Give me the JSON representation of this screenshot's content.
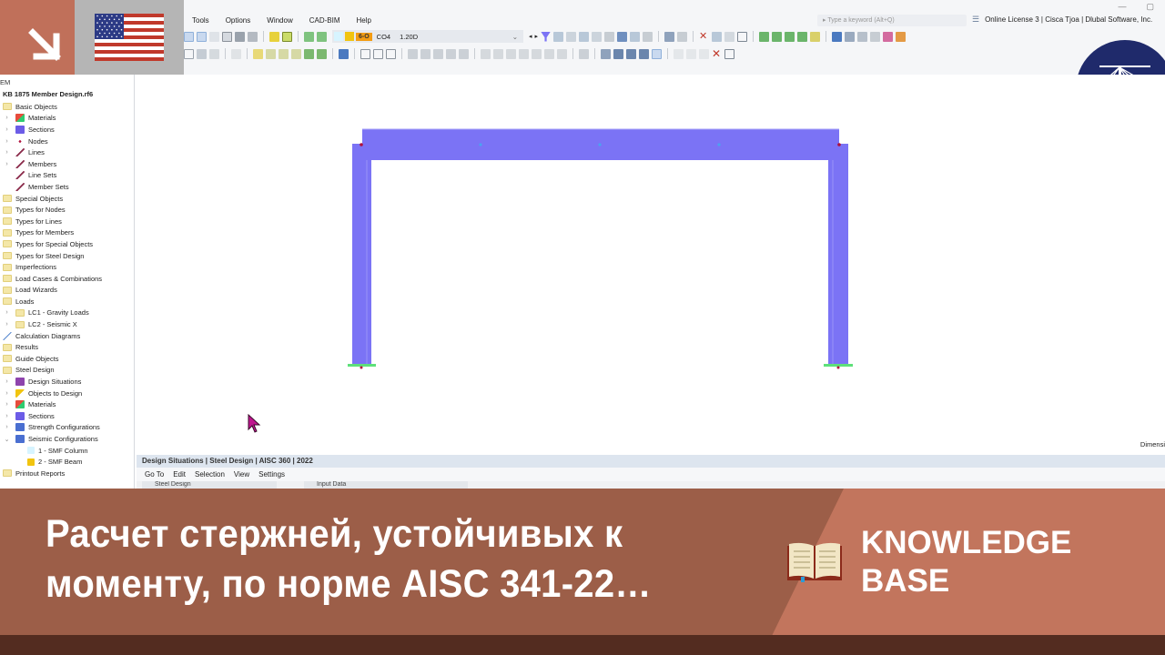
{
  "app": {
    "menu": [
      "Tools",
      "Options",
      "Window",
      "CAD-BIM",
      "Help"
    ],
    "window_controls": [
      "minimize",
      "restore"
    ],
    "search": {
      "placeholder": "Type a keyword (Alt+Q)"
    },
    "license": "Online License 3 | Cisca Tjoa | Dlubal Software, Inc.",
    "load_combo": {
      "tag": "6-O",
      "code": "CO4",
      "description": "1.20D"
    }
  },
  "navigator": {
    "header": "EM",
    "file": "KB 1875 Member Design.rf6",
    "items": [
      {
        "label": "Basic Objects",
        "level": 0,
        "icon": "folder-icon"
      },
      {
        "label": "Materials",
        "level": 1,
        "expandable": true,
        "icon": "materials-icon"
      },
      {
        "label": "Sections",
        "level": 1,
        "expandable": true,
        "icon": "sections-icon"
      },
      {
        "label": "Nodes",
        "level": 1,
        "expandable": true,
        "icon": "nodes-icon"
      },
      {
        "label": "Lines",
        "level": 1,
        "expandable": true,
        "icon": "lines-icon"
      },
      {
        "label": "Members",
        "level": 1,
        "expandable": true,
        "icon": "members-icon"
      },
      {
        "label": "Line Sets",
        "level": 1,
        "expandable": false,
        "icon": "line-sets-icon"
      },
      {
        "label": "Member Sets",
        "level": 1,
        "expandable": false,
        "icon": "member-sets-icon"
      },
      {
        "label": "Special Objects",
        "level": 0,
        "icon": "folder-icon"
      },
      {
        "label": "Types for Nodes",
        "level": 0,
        "icon": "folder-icon"
      },
      {
        "label": "Types for Lines",
        "level": 0,
        "icon": "folder-icon"
      },
      {
        "label": "Types for Members",
        "level": 0,
        "icon": "folder-icon"
      },
      {
        "label": "Types for Special Objects",
        "level": 0,
        "icon": "folder-icon"
      },
      {
        "label": "Types for Steel Design",
        "level": 0,
        "icon": "folder-icon"
      },
      {
        "label": "Imperfections",
        "level": 0,
        "icon": "folder-icon"
      },
      {
        "label": "Load Cases & Combinations",
        "level": 0,
        "icon": "folder-icon"
      },
      {
        "label": "Load Wizards",
        "level": 0,
        "icon": "folder-icon"
      },
      {
        "label": "Loads",
        "level": 0,
        "icon": "folder-icon"
      },
      {
        "label": "LC1 - Gravity Loads",
        "level": 1,
        "expandable": true,
        "icon": "folder-icon"
      },
      {
        "label": "LC2 - Seismic X",
        "level": 1,
        "expandable": true,
        "icon": "folder-icon"
      },
      {
        "label": "Calculation Diagrams",
        "level": 0,
        "icon": "diagram-icon"
      },
      {
        "label": "Results",
        "level": 0,
        "icon": "folder-icon"
      },
      {
        "label": "Guide Objects",
        "level": 0,
        "icon": "folder-icon"
      },
      {
        "label": "Steel Design",
        "level": 0,
        "icon": "folder-icon"
      },
      {
        "label": "Design Situations",
        "level": 1,
        "expandable": true,
        "icon": "design-situations-icon"
      },
      {
        "label": "Objects to Design",
        "level": 1,
        "expandable": true,
        "icon": "objects-to-design-icon"
      },
      {
        "label": "Materials",
        "level": 1,
        "expandable": true,
        "icon": "materials-icon"
      },
      {
        "label": "Sections",
        "level": 1,
        "expandable": true,
        "icon": "sections-icon"
      },
      {
        "label": "Strength Configurations",
        "level": 1,
        "expandable": true,
        "icon": "strength-config-icon"
      },
      {
        "label": "Seismic Configurations",
        "level": 1,
        "expandable": true,
        "expanded": true,
        "icon": "seismic-config-icon"
      },
      {
        "label": "1 - SMF Column",
        "level": 2,
        "icon": "swatch-icon",
        "color": "#d7f4ff"
      },
      {
        "label": "2 - SMF Beam",
        "level": 2,
        "icon": "swatch-icon",
        "color": "#f1c40f"
      },
      {
        "label": "Printout Reports",
        "level": 0,
        "icon": "folder-icon"
      }
    ]
  },
  "viewport": {
    "dimension_label": "Dimensi",
    "member_color": "#7b73f5",
    "support_color": "#5ee07a",
    "node_color": "#b0103c"
  },
  "table_panel": {
    "title": "Design Situations | Steel Design | AISC 360 | 2022",
    "menu": [
      "Go To",
      "Edit",
      "Selection",
      "View",
      "Settings"
    ],
    "module_combo": "Steel Design",
    "mode_combo": "Input Data"
  },
  "banner": {
    "title": "Расчет стержней, устойчивых к моменту, по норме AISC 341-22…",
    "category": "KNOWLEDGE BASE",
    "category_line1": "KNOWLEDGE",
    "category_line2": "BASE",
    "brand": "Dlubal",
    "colors": {
      "left": "#9c5e48",
      "right": "#c2755d",
      "footer": "#532c20",
      "arrow_tile": "#c0705a",
      "logo": "#1f2a6b"
    }
  }
}
